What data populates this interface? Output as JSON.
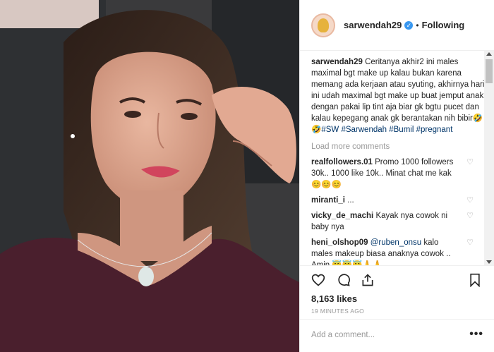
{
  "post": {
    "username": "sarwendah29",
    "follow_status": "Following",
    "separator": "•",
    "verified_glyph": "✓"
  },
  "caption": {
    "username": "sarwendah29",
    "text": "Ceritanya akhir2 ini males maximal bgt make up kalau bukan karena memang ada kerjaan atau syuting, akhirnya hari ini udah maximal bgt make up buat jemput anak dengan pakai lip tint aja biar gk bgtu pucet dan kalau kepegang anak gk berantakan nih bibir",
    "emoji": "🤣🤣",
    "hashtags": [
      "#SW",
      "#Sarwendah",
      "#Bumil",
      "#pregnant"
    ]
  },
  "load_more": "Load more comments",
  "comments": [
    {
      "user": "realfollowers.01",
      "text": "Promo 1000 followers 30k.. 1000 like 10k.. Minat chat me kak 😊😊😊"
    },
    {
      "user": "miranti_i",
      "text": "..."
    },
    {
      "user": "vicky_de_machi",
      "text": "Kayak nya cowok ni baby nya"
    },
    {
      "user": "heni_olshop09",
      "mention": "@ruben_onsu",
      "text": "kalo males makeup biasa anaknya cowok .. Amin 😇😇😇🙏🙏"
    }
  ],
  "likes": "8,163 likes",
  "timestamp": "19 MINUTES AGO",
  "add_comment_placeholder": "Add a comment...",
  "more_glyph": "•••",
  "icons": [
    "heart-icon",
    "comment-icon",
    "share-icon",
    "bookmark-icon"
  ]
}
